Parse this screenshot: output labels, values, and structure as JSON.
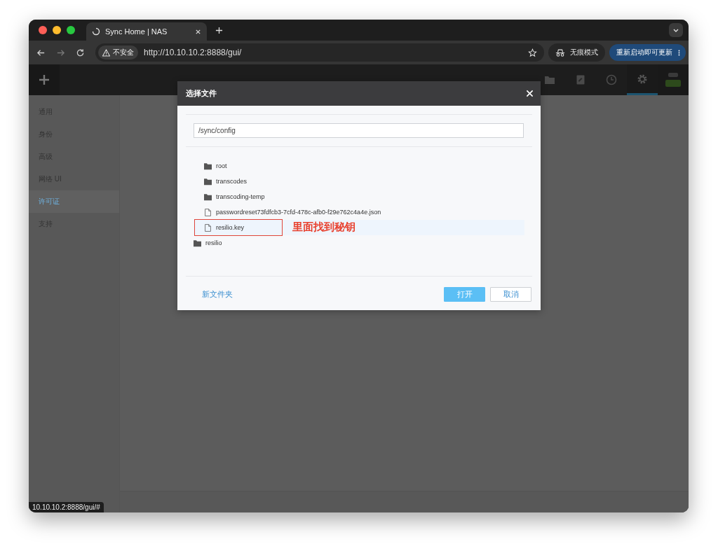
{
  "browser": {
    "tab": {
      "title": "Sync Home | NAS"
    },
    "address": {
      "security": "不安全",
      "url": "http://10.10.10.2:8888/gui/"
    },
    "profile": "无痕模式",
    "update": "重新启动即可更新"
  },
  "app": {
    "nav": [
      {
        "kind": "folder",
        "selected": false
      },
      {
        "kind": "document",
        "selected": false
      },
      {
        "kind": "clock",
        "selected": false
      },
      {
        "kind": "gear",
        "selected": true
      }
    ],
    "sidebar": [
      {
        "label": "通用",
        "selected": false
      },
      {
        "label": "身份",
        "selected": false
      },
      {
        "label": "高级",
        "selected": false
      },
      {
        "label": "网络 UI",
        "selected": false
      },
      {
        "label": "许可证",
        "selected": true
      },
      {
        "label": "支持",
        "selected": false
      }
    ]
  },
  "dialog": {
    "title": "选择文件",
    "path": "/sync/config",
    "nested_items": [
      {
        "name": "root",
        "kind": "folder",
        "selected": false
      },
      {
        "name": "transcodes",
        "kind": "folder",
        "selected": false
      },
      {
        "name": "transcoding-temp",
        "kind": "folder",
        "selected": false
      },
      {
        "name": "passwordreset73fdfcb3-7cfd-478c-afb0-f29e762c4a4e.json",
        "kind": "file",
        "selected": false
      },
      {
        "name": "resilio.key",
        "kind": "file",
        "selected": true
      }
    ],
    "items": [
      {
        "name": "resilio",
        "kind": "folder",
        "selected": false
      }
    ],
    "annotation": "里面找到秘钥",
    "new_folder": "新文件夹",
    "buttons": [
      {
        "label": "打开",
        "kind": "primary"
      },
      {
        "label": "取消",
        "kind": "secondary"
      }
    ]
  },
  "status_bubble": "10.10.10.2:8888/gui/#"
}
